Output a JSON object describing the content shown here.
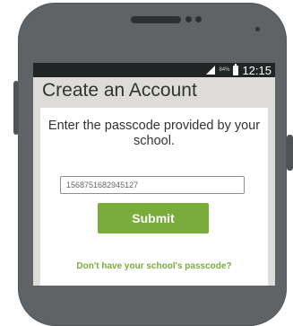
{
  "status_bar": {
    "battery_percent": "84%",
    "time": "12:15",
    "signal_icon": "signal-icon",
    "battery_icon": "battery-icon"
  },
  "screen": {
    "title": "Create an Account",
    "instruction": "Enter the passcode provided by your school.",
    "passcode_value": "1568751682945127",
    "submit_label": "Submit",
    "help_link": "Don't have your school's passcode?"
  },
  "colors": {
    "accent": "#7aac3c",
    "background": "#dddcd9",
    "status_bar": "#222526"
  }
}
